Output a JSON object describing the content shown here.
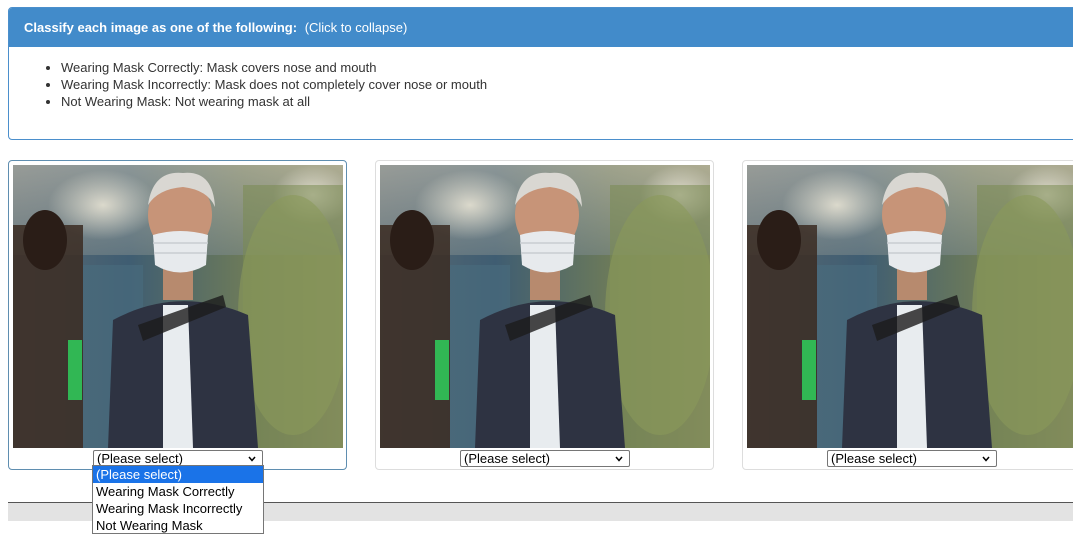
{
  "instructions": {
    "title": "Classify each image as one of the following:",
    "collapse_hint": "(Click to collapse)",
    "items": [
      "Wearing Mask Correctly: Mask covers nose and mouth",
      "Wearing Mask Incorrectly: Mask does not completely cover nose or mouth",
      "Not Wearing Mask: Not wearing mask at all"
    ]
  },
  "cards": [
    {
      "select_value": "(Please select)"
    },
    {
      "select_value": "(Please select)"
    },
    {
      "select_value": "(Please select)"
    }
  ],
  "dropdown": {
    "options": [
      "(Please select)",
      "Wearing Mask Correctly",
      "Wearing Mask Incorrectly",
      "Not Wearing Mask"
    ],
    "highlighted_index": 0
  },
  "colors": {
    "header_bg": "#428bca",
    "highlight": "#1a73e8"
  }
}
